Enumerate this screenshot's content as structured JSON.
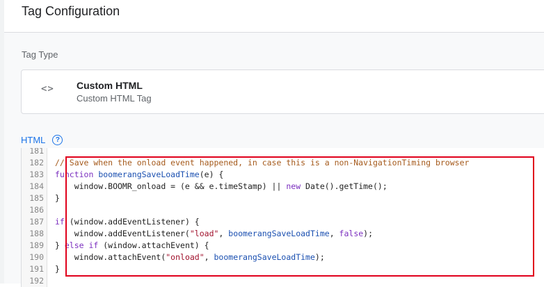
{
  "header": {
    "title": "Tag Configuration"
  },
  "tag_type": {
    "section_label": "Tag Type",
    "icon": "code-icon",
    "name": "Custom HTML",
    "subtitle": "Custom HTML Tag"
  },
  "html_section": {
    "label": "HTML",
    "help_icon": "help-circle-icon"
  },
  "editor": {
    "lines": [
      {
        "n": "181",
        "segments": []
      },
      {
        "n": "182",
        "segments": [
          {
            "t": "// Save when the onload event happened, in case this is a non-NavigationTiming browser",
            "c": "c-comment"
          }
        ]
      },
      {
        "n": "183",
        "segments": [
          {
            "t": "function ",
            "c": "c-kw"
          },
          {
            "t": "boomerangSaveLoadTime",
            "c": "c-fn"
          },
          {
            "t": "(e) {",
            "c": "c-plain"
          }
        ]
      },
      {
        "n": "184",
        "segments": [
          {
            "t": "    window.BOOMR_onload = (e && e.timeStamp) || ",
            "c": "c-plain"
          },
          {
            "t": "new ",
            "c": "c-kw"
          },
          {
            "t": "Date().getTime();",
            "c": "c-plain"
          }
        ]
      },
      {
        "n": "185",
        "segments": [
          {
            "t": "}",
            "c": "c-plain"
          }
        ]
      },
      {
        "n": "186",
        "segments": []
      },
      {
        "n": "187",
        "segments": [
          {
            "t": "if ",
            "c": "c-kw"
          },
          {
            "t": "(window.addEventListener) {",
            "c": "c-plain"
          }
        ]
      },
      {
        "n": "188",
        "segments": [
          {
            "t": "    window.addEventListener(",
            "c": "c-plain"
          },
          {
            "t": "\"load\"",
            "c": "c-str"
          },
          {
            "t": ", ",
            "c": "c-plain"
          },
          {
            "t": "boomerangSaveLoadTime",
            "c": "c-fn"
          },
          {
            "t": ", ",
            "c": "c-plain"
          },
          {
            "t": "false",
            "c": "c-kw"
          },
          {
            "t": ");",
            "c": "c-plain"
          }
        ]
      },
      {
        "n": "189",
        "segments": [
          {
            "t": "} ",
            "c": "c-plain"
          },
          {
            "t": "else if ",
            "c": "c-kw"
          },
          {
            "t": "(window.attachEvent) {",
            "c": "c-plain"
          }
        ]
      },
      {
        "n": "190",
        "segments": [
          {
            "t": "    window.attachEvent(",
            "c": "c-plain"
          },
          {
            "t": "\"onload\"",
            "c": "c-str"
          },
          {
            "t": ", ",
            "c": "c-plain"
          },
          {
            "t": "boomerangSaveLoadTime",
            "c": "c-fn"
          },
          {
            "t": ");",
            "c": "c-plain"
          }
        ]
      },
      {
        "n": "191",
        "segments": [
          {
            "t": "}",
            "c": "c-plain"
          }
        ]
      },
      {
        "n": "192",
        "segments": []
      }
    ]
  },
  "colors": {
    "accent": "#1a73e8",
    "highlight_border": "#e0001b"
  }
}
